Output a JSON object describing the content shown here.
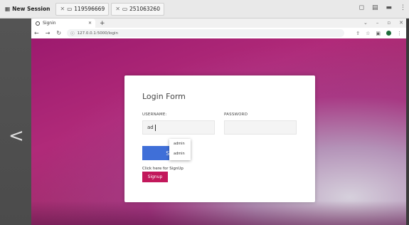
{
  "viewer": {
    "session_label": "New Session",
    "tabs": [
      {
        "label": "119596669"
      },
      {
        "label": "251063260"
      }
    ]
  },
  "browser": {
    "tab_title": "Signin",
    "url": "127.0.0.1:5000/login"
  },
  "form": {
    "title": "Login Form",
    "username_label": "USERNAME:",
    "username_value": "ad",
    "password_label": "PASSWORD",
    "submit_label": "Submit",
    "autocomplete": [
      "admin",
      "admin"
    ],
    "signup_prompt": "Click here for SignUp",
    "signup_label": "Signup"
  },
  "colors": {
    "submit": "#3f6fd8",
    "signup": "#c2185b",
    "background": "#a0306e"
  }
}
